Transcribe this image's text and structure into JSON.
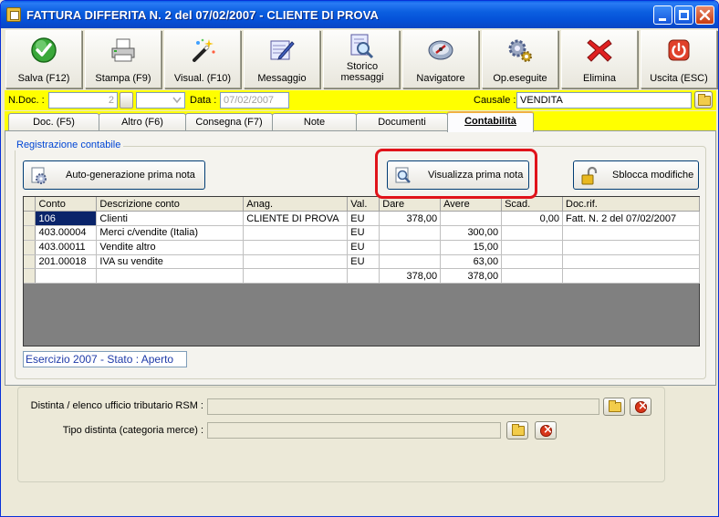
{
  "window": {
    "title": "FATTURA DIFFERITA N.  2  del 07/02/2007 - CLIENTE DI PROVA"
  },
  "toolbar": [
    {
      "label": "Salva (F12)",
      "icon": "save-check-icon"
    },
    {
      "label": "Stampa (F9)",
      "icon": "printer-icon"
    },
    {
      "label": "Visual. (F10)",
      "icon": "magic-wand-icon"
    },
    {
      "label": "Messaggio",
      "icon": "message-pen-icon"
    },
    {
      "label": "Storico messaggi",
      "icon": "message-history-icon"
    },
    {
      "label": "Navigatore",
      "icon": "navigator-icon"
    },
    {
      "label": "Op.eseguite",
      "icon": "gears-icon"
    },
    {
      "label": "Elimina",
      "icon": "delete-x-icon"
    },
    {
      "label": "Uscita (ESC)",
      "icon": "power-exit-icon"
    }
  ],
  "docbar": {
    "ndoc_label": "N.Doc. :",
    "ndoc_value": "2",
    "data_label": "Data :",
    "data_value": "07/02/2007",
    "causale_label": "Causale :",
    "causale_value": "VENDITA"
  },
  "tabs": [
    {
      "label": "Doc. (F5)",
      "active": false
    },
    {
      "label": "Altro (F6)",
      "active": false
    },
    {
      "label": "Consegna (F7)",
      "active": false
    },
    {
      "label": "Note",
      "active": false
    },
    {
      "label": "Documenti",
      "active": false
    },
    {
      "label": "Contabilità",
      "active": true
    }
  ],
  "registrazione": {
    "group_title": "Registrazione contabile",
    "auto_button": "Auto-generazione prima nota",
    "view_button": "Visualizza prima nota",
    "unlock_button": "Sblocca modifiche"
  },
  "grid": {
    "columns": [
      "Conto",
      "Descrizione conto",
      "Anag.",
      "Val.",
      "Dare",
      "Avere",
      "Scad.",
      "Doc.rif."
    ],
    "rows": [
      [
        "106",
        "Clienti",
        "CLIENTE DI PROVA",
        "EU",
        "378,00",
        "",
        "0,00",
        "Fatt. N. 2 del 07/02/2007"
      ],
      [
        "403.00004",
        "Merci c/vendite (Italia)",
        "",
        "EU",
        "",
        "300,00",
        "",
        ""
      ],
      [
        "403.00011",
        "Vendite altro",
        "",
        "EU",
        "",
        "15,00",
        "",
        ""
      ],
      [
        "201.00018",
        "IVA su vendite",
        "",
        "EU",
        "",
        "63,00",
        "",
        ""
      ]
    ],
    "totals": {
      "dare": "378,00",
      "avere": "378,00"
    }
  },
  "status": "Esercizio 2007 - Stato : Aperto",
  "bottom": {
    "distinta_label": "Distinta / elenco ufficio tributario RSM :",
    "tipo_label": "Tipo distinta (categoria merce) :"
  },
  "colors": {
    "title_blue": "#0b5fe0",
    "yellow_bar": "#ffff00",
    "highlight_red": "#e0131a",
    "status_text": "#1e3aa8"
  }
}
